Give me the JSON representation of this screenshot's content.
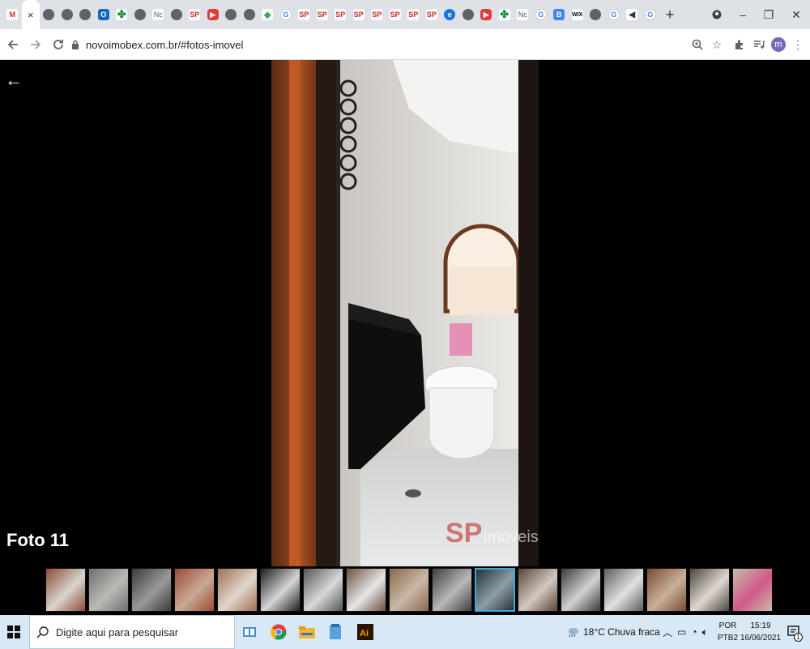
{
  "browser": {
    "tabs": [
      {
        "icon": "gmail-icon",
        "cls": "gmail",
        "glyph": "M"
      },
      {
        "icon": "close-tab-icon",
        "cls": "",
        "glyph": "×",
        "active": true
      },
      {
        "icon": "globe-icon",
        "cls": "globe",
        "glyph": ""
      },
      {
        "icon": "globe-icon",
        "cls": "globe",
        "glyph": ""
      },
      {
        "icon": "globe-icon",
        "cls": "globe",
        "glyph": ""
      },
      {
        "icon": "outlook-icon",
        "cls": "ol",
        "glyph": "O"
      },
      {
        "icon": "clover-icon",
        "cls": "clover",
        "glyph": "✤"
      },
      {
        "icon": "globe-icon",
        "cls": "globe",
        "glyph": ""
      },
      {
        "icon": "nc-icon",
        "cls": "nc",
        "glyph": "Nc"
      },
      {
        "icon": "globe-icon",
        "cls": "globe",
        "glyph": ""
      },
      {
        "icon": "sp-icon",
        "cls": "sp",
        "glyph": "SP"
      },
      {
        "icon": "youtube-icon",
        "cls": "yt",
        "glyph": "▶"
      },
      {
        "icon": "globe-icon",
        "cls": "globe",
        "glyph": ""
      },
      {
        "icon": "globe-icon",
        "cls": "globe",
        "glyph": ""
      },
      {
        "icon": "maps-icon",
        "cls": "maps",
        "glyph": "⬥"
      },
      {
        "icon": "google-icon",
        "cls": "g",
        "glyph": "G"
      },
      {
        "icon": "sp-icon",
        "cls": "sp",
        "glyph": "SP"
      },
      {
        "icon": "sp-icon",
        "cls": "sp",
        "glyph": "SP"
      },
      {
        "icon": "sp-icon",
        "cls": "sp",
        "glyph": "SP"
      },
      {
        "icon": "sp-icon",
        "cls": "sp",
        "glyph": "SP"
      },
      {
        "icon": "sp-icon",
        "cls": "sp",
        "glyph": "SP"
      },
      {
        "icon": "sp-icon",
        "cls": "sp",
        "glyph": "SP"
      },
      {
        "icon": "sp-icon",
        "cls": "sp",
        "glyph": "SP"
      },
      {
        "icon": "sp-icon",
        "cls": "sp",
        "glyph": "SP"
      },
      {
        "icon": "blue-circle-icon",
        "cls": "blue",
        "glyph": "e"
      },
      {
        "icon": "globe-icon",
        "cls": "globe",
        "glyph": ""
      },
      {
        "icon": "youtube-icon",
        "cls": "yt",
        "glyph": "▶"
      },
      {
        "icon": "clover-icon",
        "cls": "clover",
        "glyph": "✤"
      },
      {
        "icon": "nc-icon",
        "cls": "nc",
        "glyph": "Nc"
      },
      {
        "icon": "google-icon",
        "cls": "g",
        "glyph": "G"
      },
      {
        "icon": "doc-icon",
        "cls": "doc",
        "glyph": "B"
      },
      {
        "icon": "wix-icon",
        "cls": "wix",
        "glyph": "WIX"
      },
      {
        "icon": "globe-icon",
        "cls": "globe",
        "glyph": ""
      },
      {
        "icon": "google-icon",
        "cls": "g",
        "glyph": "G"
      },
      {
        "icon": "speaker-icon",
        "cls": "spk",
        "glyph": "◀"
      },
      {
        "icon": "google-icon",
        "cls": "g",
        "glyph": "G"
      }
    ],
    "new_tab": "+",
    "url": "novoimobex.com.br/#fotos-imovel",
    "avatar_letter": "m"
  },
  "viewer": {
    "back": "←",
    "photo_title": "Foto 11",
    "watermark": "SP imoveis",
    "thumb_count": 17,
    "active_thumb": 10,
    "thumbs": [
      {
        "c1": "#8a4a3a",
        "c2": "#d9d4cc"
      },
      {
        "c1": "#6e6f72",
        "c2": "#bcbab5"
      },
      {
        "c1": "#3a3a3a",
        "c2": "#9a9a98"
      },
      {
        "c1": "#9a4b34",
        "c2": "#c9a896"
      },
      {
        "c1": "#a07050",
        "c2": "#e0d6cc"
      },
      {
        "c1": "#1e1e1e",
        "c2": "#d4d4d4"
      },
      {
        "c1": "#555",
        "c2": "#d8d8d8"
      },
      {
        "c1": "#6a5040",
        "c2": "#e6e6e6"
      },
      {
        "c1": "#8a6848",
        "c2": "#c8b8a8"
      },
      {
        "c1": "#3e3e40",
        "c2": "#b8b8b8"
      },
      {
        "c1": "#2a3036",
        "c2": "#8aa0a8"
      },
      {
        "c1": "#5a4438",
        "c2": "#d2c8c0"
      },
      {
        "c1": "#3a3a3a",
        "c2": "#d0d0d0"
      },
      {
        "c1": "#5c5c5c",
        "c2": "#e0e0e0"
      },
      {
        "c1": "#7a4a30",
        "c2": "#c8b098"
      },
      {
        "c1": "#4a4440",
        "c2": "#e0d8d0"
      },
      {
        "c1": "#c8bba8",
        "c2": "#d05a8a"
      }
    ]
  },
  "taskbar": {
    "search_placeholder": "Digite aqui para pesquisar",
    "weather": "18°C  Chuva fraca",
    "lang1": "POR",
    "lang2": "PTB2",
    "time": "15:19",
    "date": "16/06/2021",
    "notif_count": "1"
  },
  "colors": {
    "accent": "#3da8e0",
    "tabstrip": "#dee1e6",
    "taskbar": "#d9e8f5"
  }
}
